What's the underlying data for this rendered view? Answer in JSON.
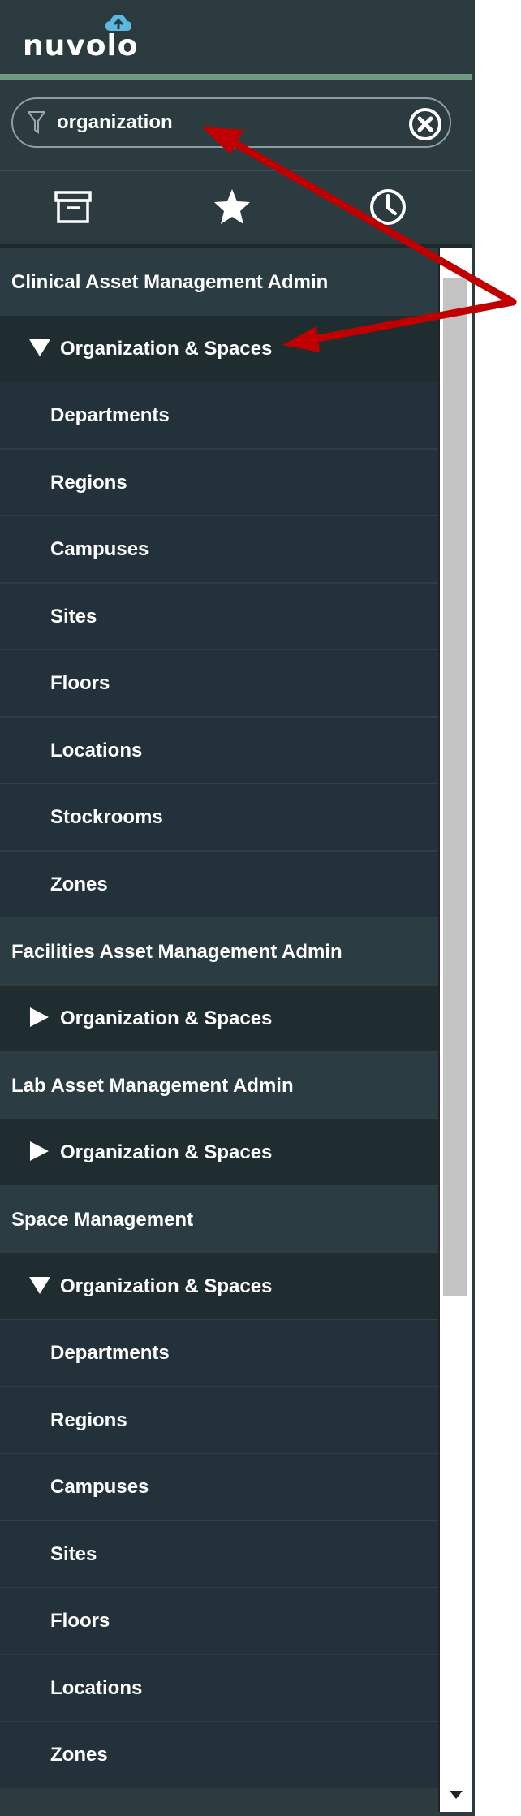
{
  "app": {
    "logo_text": "nuvolo"
  },
  "filter": {
    "value": "organization",
    "placeholder": ""
  },
  "tabs": [
    {
      "icon": "archive-icon"
    },
    {
      "icon": "star-icon"
    },
    {
      "icon": "history-clock-icon"
    }
  ],
  "menu": {
    "sections": [
      {
        "label": "Clinical Asset Management Admin",
        "modules": [
          {
            "label": "Organization & Spaces",
            "expanded": true,
            "items": [
              "Departments",
              "Regions",
              "Campuses",
              "Sites",
              "Floors",
              "Locations",
              "Stockrooms",
              "Zones"
            ]
          }
        ]
      },
      {
        "label": "Facilities Asset Management Admin",
        "modules": [
          {
            "label": "Organization & Spaces",
            "expanded": false,
            "items": []
          }
        ]
      },
      {
        "label": "Lab Asset Management Admin",
        "modules": [
          {
            "label": "Organization & Spaces",
            "expanded": false,
            "items": []
          }
        ]
      },
      {
        "label": "Space Management",
        "modules": [
          {
            "label": "Organization & Spaces",
            "expanded": true,
            "items": [
              "Departments",
              "Regions",
              "Campuses",
              "Sites",
              "Floors",
              "Locations",
              "Zones"
            ]
          }
        ]
      }
    ]
  },
  "colors": {
    "nav_bg": "#2b3b40",
    "accent_rule": "#6e9a82",
    "annotation_arrow": "#c00000"
  }
}
